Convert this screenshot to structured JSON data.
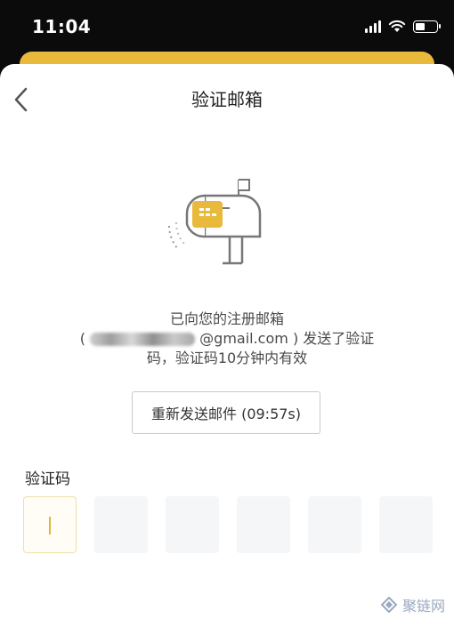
{
  "status_bar": {
    "time": "11:04",
    "icons": [
      "cellular-signal-icon",
      "wifi-icon",
      "battery-icon"
    ]
  },
  "header": {
    "title": "验证邮箱",
    "back_icon": "chevron-left-icon"
  },
  "illustration": {
    "icon": "mailbox-icon",
    "accent_color": "#E9B93C"
  },
  "message": {
    "line1": "已向您的注册邮箱",
    "email_prefix": "(",
    "email_domain": "@gmail.com ) 发送了验证",
    "line3": "码，验证码10分钟内有效"
  },
  "resend_button": {
    "label": "重新发送邮件 (09:57s)"
  },
  "code_input": {
    "label": "验证码",
    "digit_count": 6,
    "values": [
      "",
      "",
      "",
      "",
      "",
      ""
    ]
  },
  "watermark": {
    "text": "聚链网"
  },
  "colors": {
    "accent": "#E9B93C",
    "background_dark": "#0B0B0B",
    "input_bg": "#F5F6F8"
  }
}
